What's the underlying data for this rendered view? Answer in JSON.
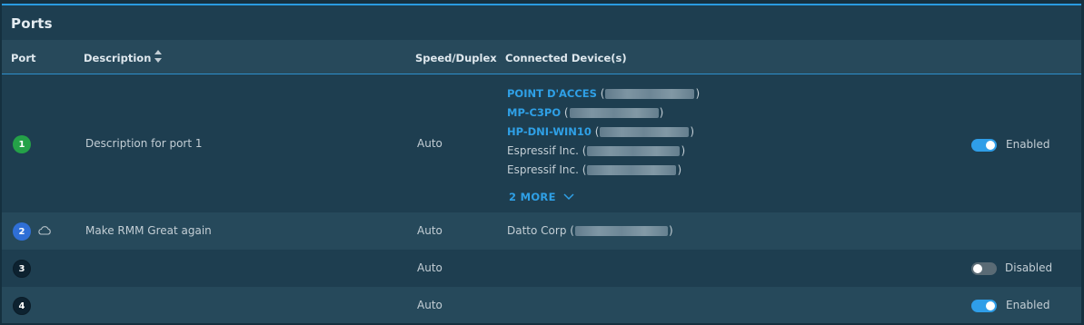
{
  "panel": {
    "title": "Ports"
  },
  "columns": {
    "port": "Port",
    "description": "Description",
    "speed": "Speed/Duplex",
    "devices": "Connected Device(s)"
  },
  "rows": [
    {
      "port": "1",
      "status_color": "#24a148",
      "description": "Description for port 1",
      "speed": "Auto",
      "devices": [
        {
          "name": "POINT D'ACCES",
          "link": true
        },
        {
          "name": "MP-C3PO",
          "link": true
        },
        {
          "name": "HP-DNI-WIN10",
          "link": true
        },
        {
          "name": "Espressif Inc.",
          "link": false
        },
        {
          "name": "Espressif Inc.",
          "link": false
        }
      ],
      "more_label": "2 MORE",
      "toggle": {
        "enabled": true,
        "label": "Enabled"
      }
    },
    {
      "port": "2",
      "status_color": "#2f6fd6",
      "uplink_icon": "cloud-icon",
      "description": "Make RMM Great again",
      "speed": "Auto",
      "devices": [
        {
          "name": "Datto Corp",
          "link": false
        }
      ]
    },
    {
      "port": "3",
      "status_color": "#0d2230",
      "description": "",
      "speed": "Auto",
      "toggle": {
        "enabled": false,
        "label": "Disabled"
      }
    },
    {
      "port": "4",
      "status_color": "#0d2230",
      "description": "",
      "speed": "Auto",
      "toggle": {
        "enabled": true,
        "label": "Enabled"
      }
    }
  ],
  "colors": {
    "accent": "#2f9ee8",
    "link": "#2fa0e6",
    "panel": "#1e3e50"
  }
}
